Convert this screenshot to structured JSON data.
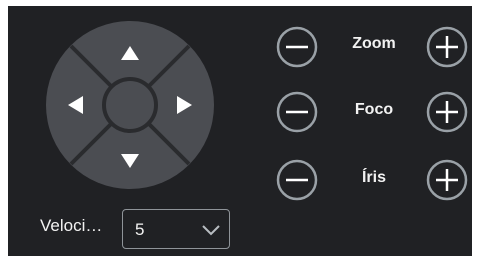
{
  "ptz": {
    "pan": {
      "up_icon": "arrow-up",
      "down_icon": "arrow-down",
      "left_icon": "arrow-left",
      "right_icon": "arrow-right"
    },
    "controls": [
      {
        "label": "Zoom",
        "minus_icon": "minus-circle",
        "plus_icon": "plus-circle"
      },
      {
        "label": "Foco",
        "minus_icon": "minus-circle",
        "plus_icon": "plus-circle"
      },
      {
        "label": "Íris",
        "minus_icon": "minus-circle",
        "plus_icon": "plus-circle"
      }
    ],
    "speed": {
      "label": "Veloci…",
      "value": "5",
      "dropdown_icon": "chevron-down"
    }
  },
  "colors": {
    "background": "#202124",
    "dpad_fill": "#4b4d52",
    "dpad_lines": "#2a2b2e",
    "button_ring": "#9aa1a7",
    "text": "#f2f2f2"
  }
}
